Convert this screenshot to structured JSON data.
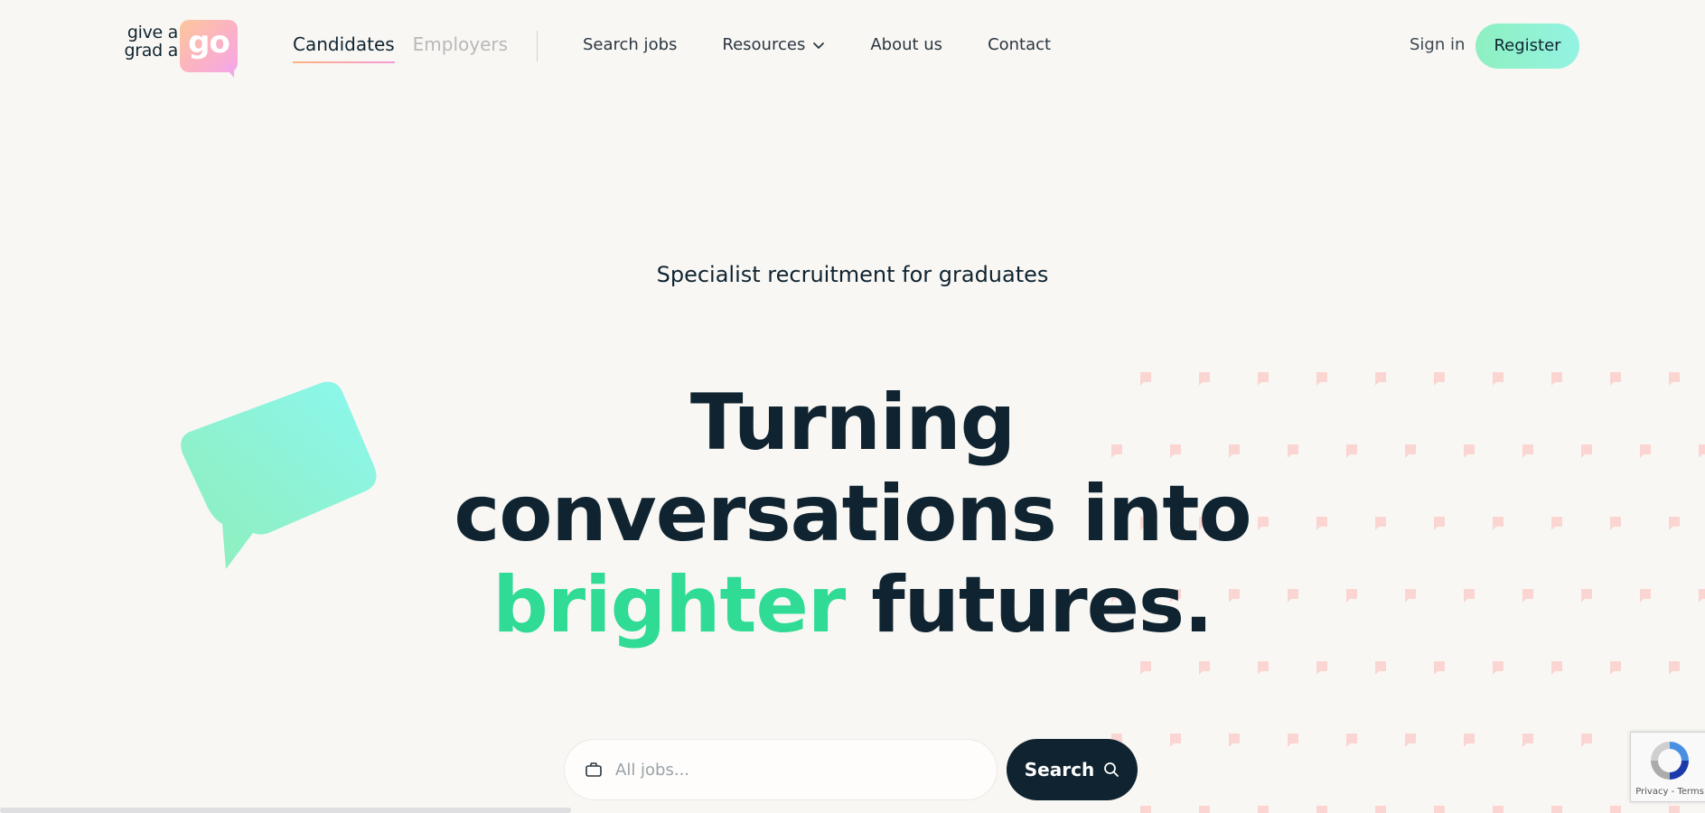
{
  "header": {
    "logo": {
      "line1": "give a",
      "line2": "grad a",
      "badge": "go"
    },
    "audience_tabs": [
      {
        "label": "Candidates",
        "active": true
      },
      {
        "label": "Employers",
        "active": false
      }
    ],
    "nav": [
      {
        "label": "Search jobs"
      },
      {
        "label": "Resources",
        "has_dropdown": true,
        "icon": "chevron-down-icon"
      },
      {
        "label": "About us"
      },
      {
        "label": "Contact"
      }
    ],
    "sign_in": "Sign in",
    "register": "Register"
  },
  "hero": {
    "tagline": "Specialist recruitment for graduates",
    "headline_line1": "Turning",
    "headline_line2": "conversations into",
    "headline_accent": "brighter",
    "headline_line3_rest": " futures."
  },
  "search": {
    "placeholder": "All jobs...",
    "value": "",
    "button_label": "Search",
    "field_icon": "briefcase-icon",
    "button_icon": "search-icon"
  },
  "recaptcha": {
    "links": "Privacy - Terms"
  },
  "colors": {
    "background": "#f9f7f4",
    "text_dark": "#0f2430",
    "accent_green": "#2fdb95",
    "register_gradient_start": "#8ef0c0",
    "register_gradient_end": "#93f3e2",
    "logo_gradient_start": "#fcc79b",
    "logo_gradient_end": "#f4a7e8",
    "dot_pattern": "#fbd5d2"
  }
}
